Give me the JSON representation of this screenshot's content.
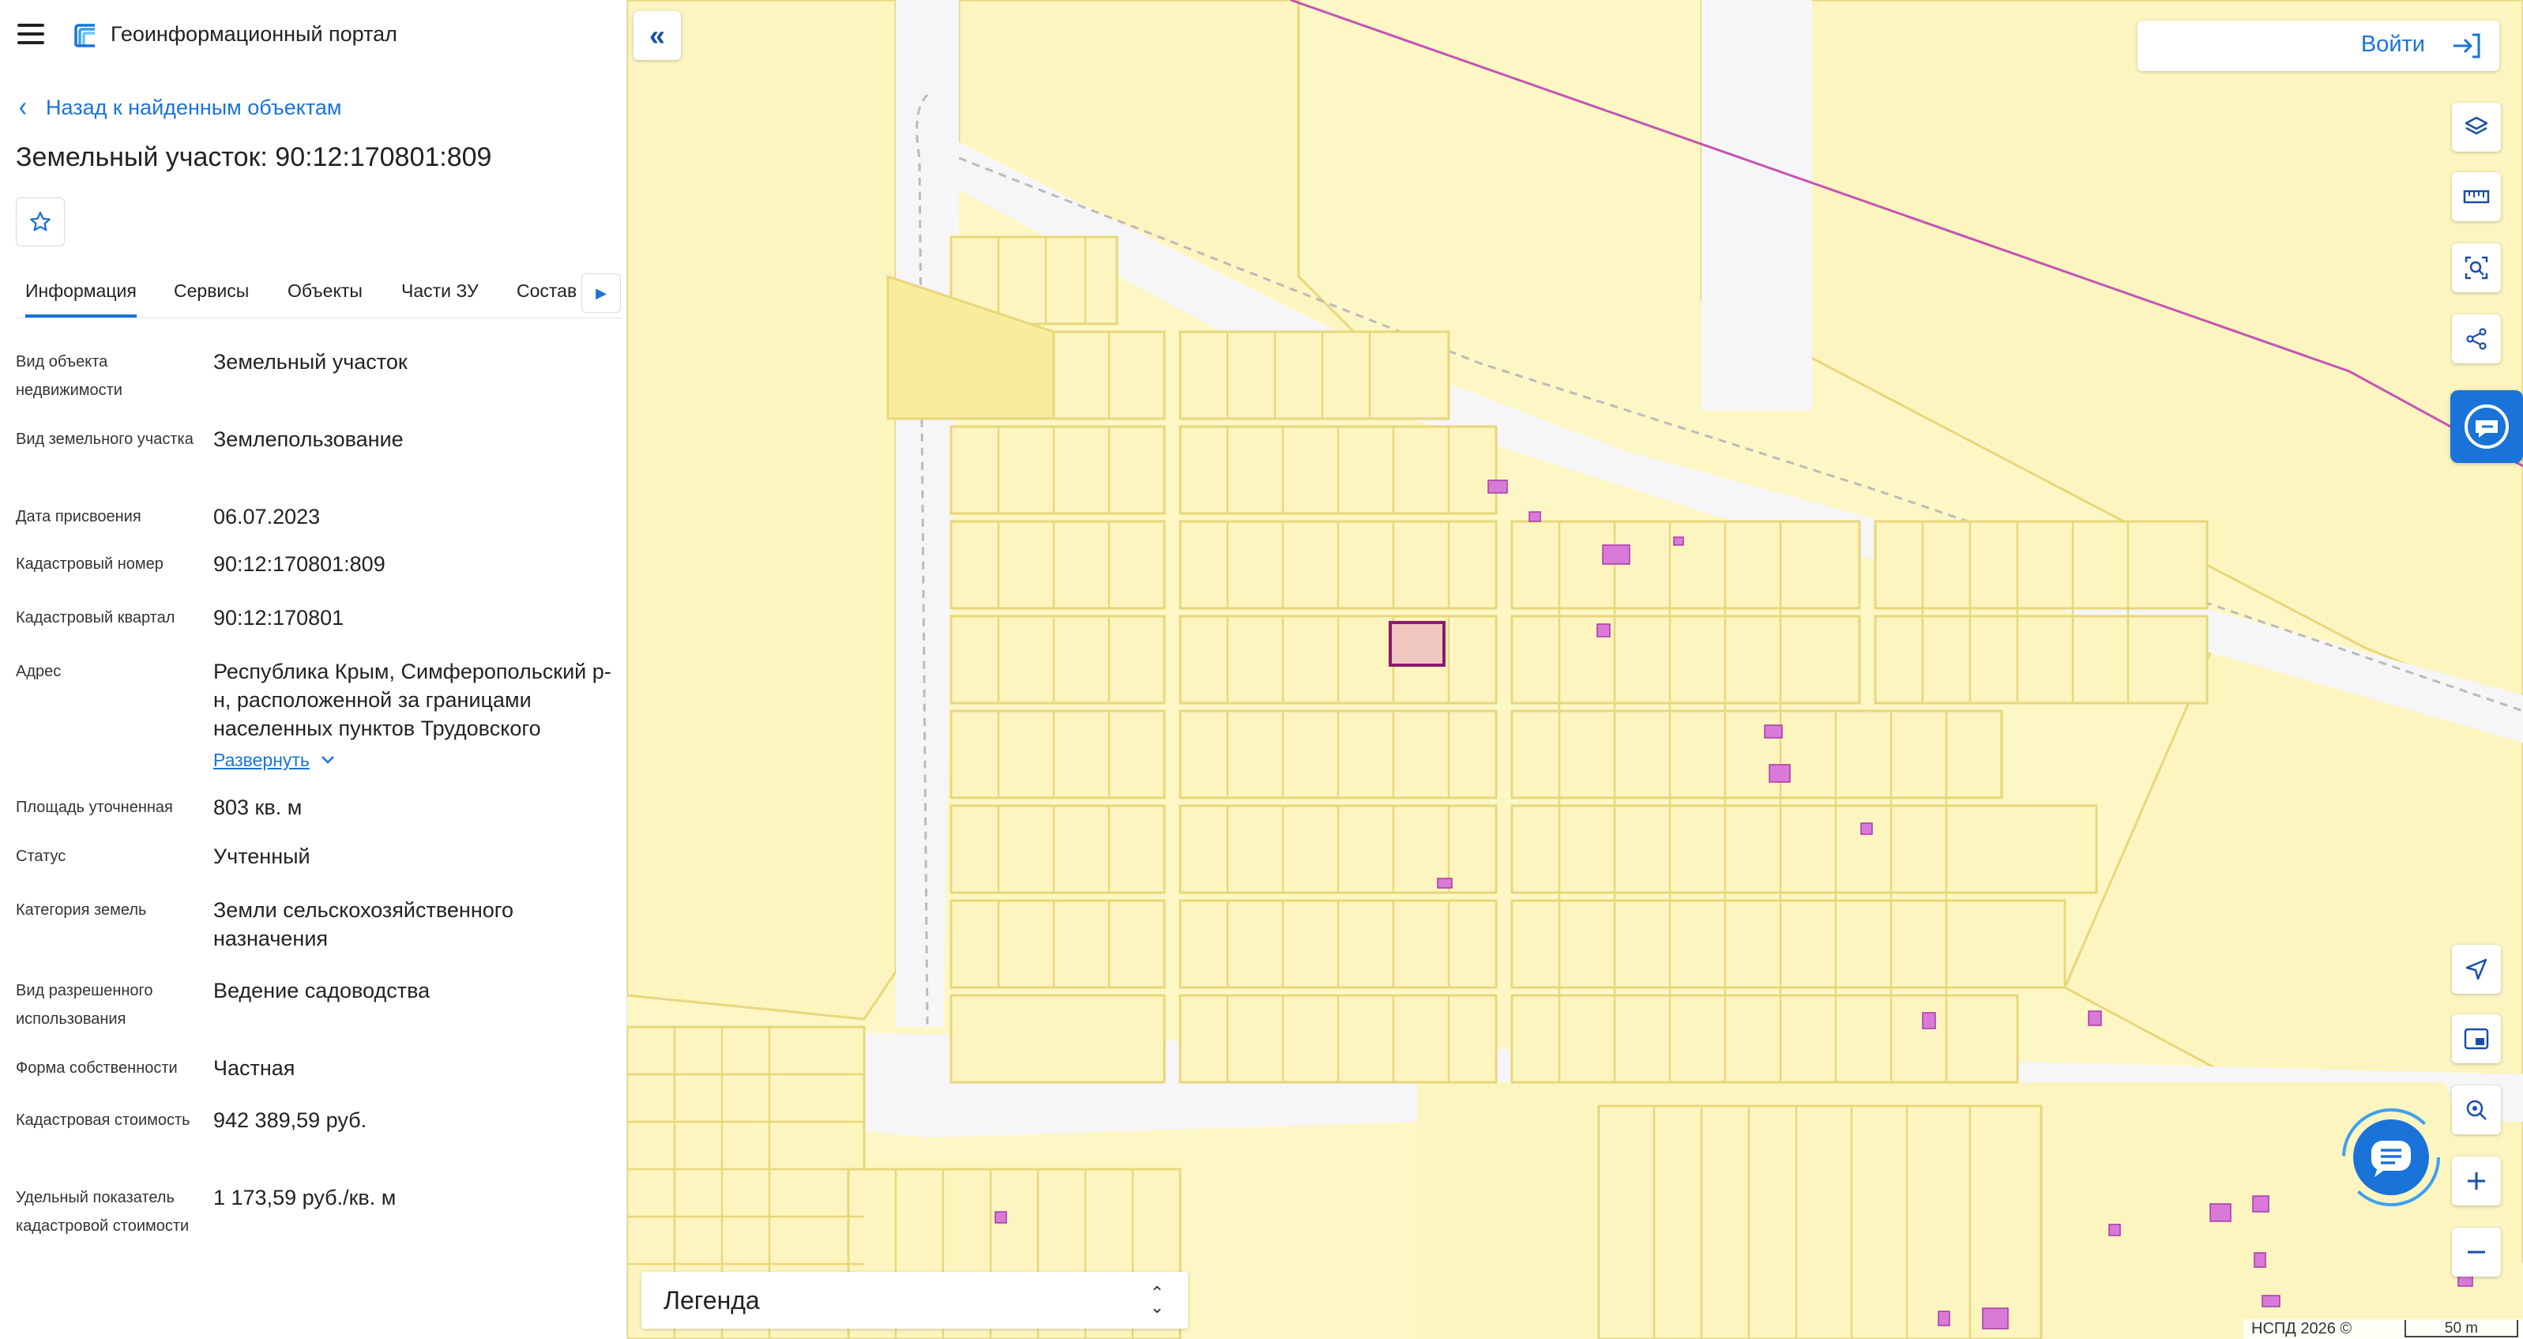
{
  "app": {
    "title": "Геоинформационный портал"
  },
  "nav": {
    "back_label": "Назад к найденным объектам"
  },
  "object": {
    "title": "Земельный участок: 90:12:170801:809"
  },
  "tabs": [
    {
      "label": "Информация",
      "active": true
    },
    {
      "label": "Сервисы",
      "active": false
    },
    {
      "label": "Объекты",
      "active": false
    },
    {
      "label": "Части ЗУ",
      "active": false
    },
    {
      "label": "Состав",
      "active": false
    }
  ],
  "info": {
    "rows": [
      {
        "label": "Вид объекта недвижимости",
        "value": "Земельный участок"
      },
      {
        "label": "Вид земельного участка",
        "value": "Землепользование"
      },
      {
        "label": "Дата присвоения",
        "value": "06.07.2023"
      },
      {
        "label": "Кадастровый номер",
        "value": "90:12:170801:809"
      },
      {
        "label": "Кадастровый квартал",
        "value": "90:12:170801"
      },
      {
        "label": "Адрес",
        "value": "Республика Крым, Симферопольский р-н, расположенной за границами населенных пунктов Трудовского",
        "expand_label": "Развернуть"
      },
      {
        "label": "Площадь уточненная",
        "value": "803 кв. м"
      },
      {
        "label": "Статус",
        "value": "Учтенный"
      },
      {
        "label": "Категория земель",
        "value": "Земли сельскохозяйственного назначения"
      },
      {
        "label": "Вид разрешенного использования",
        "value": "Ведение садоводства"
      },
      {
        "label": "Форма собственности",
        "value": "Частная"
      },
      {
        "label": "Кадастровая стоимость",
        "value": "942 389,59 руб."
      },
      {
        "label": "Удельный показатель кадастровой стоимости",
        "value": "1 173,59 руб./кв. м"
      }
    ]
  },
  "map": {
    "login_label": "Войти",
    "legend_label": "Легенда",
    "attribution": "НСПД 2026 ©",
    "scale_label": "50 m",
    "colors": {
      "accent": "#1a73d9",
      "parcel_fill": "#fdf5c0",
      "parcel_stroke": "#e8d77a",
      "selected": "#8b1a6e"
    }
  },
  "icons": {
    "menu": "hamburger-icon",
    "logo": "portal-logo",
    "back": "chevron-left-icon",
    "favorite": "star-icon",
    "tabs_next": "caret-right-icon",
    "collapse": "double-chevron-left-icon",
    "login": "login-arrow-icon",
    "layers": "layers-icon",
    "ruler": "ruler-icon",
    "area_select": "area-search-icon",
    "share": "share-icon",
    "assistant": "assistant-icon",
    "locate": "navigation-arrow-icon",
    "minimap": "minimap-icon",
    "search_location": "search-location-icon",
    "zoom_in": "plus-icon",
    "zoom_out": "minus-icon",
    "chat": "chat-icon",
    "legend_toggle": "sort-updown-icon"
  }
}
